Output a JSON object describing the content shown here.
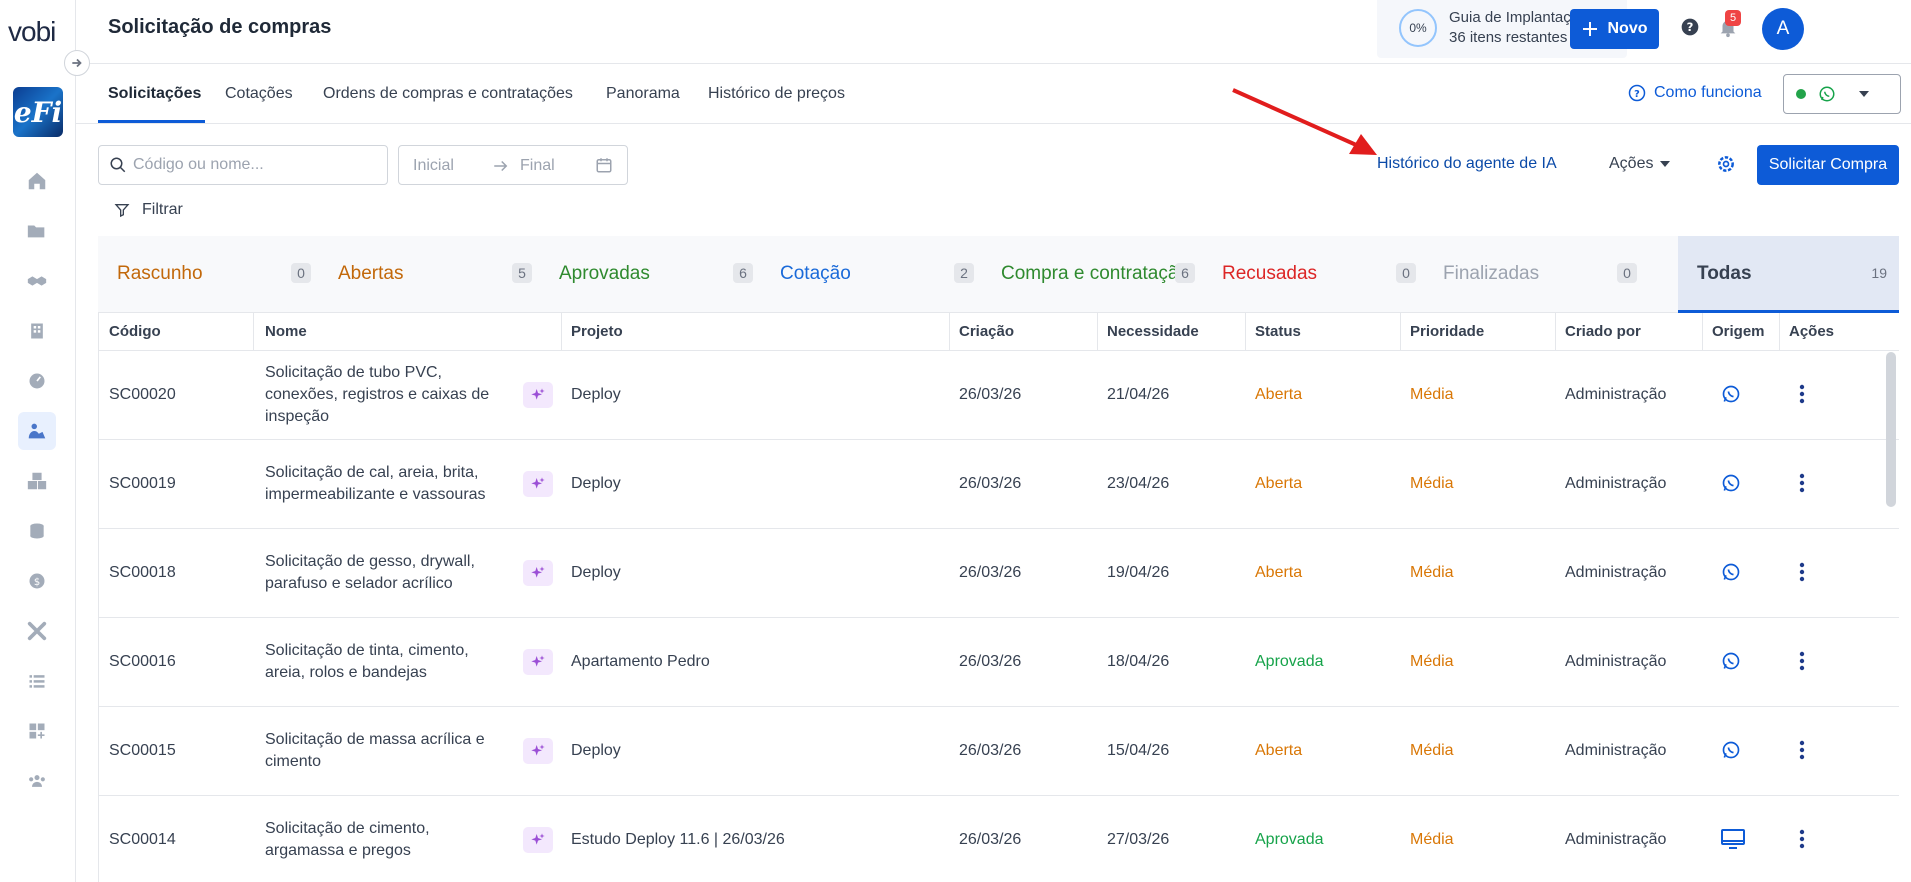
{
  "app": {
    "logo": "vobi",
    "company_logo": "eFi"
  },
  "header": {
    "title": "Solicitação de compras",
    "guide": {
      "percent": "0%",
      "title": "Guia de Implantação",
      "subtitle": "36 itens restantes"
    },
    "new_button": "Novo",
    "notifications": "5",
    "avatar": "A"
  },
  "sidebar": {
    "items": [
      {
        "icon": "home-icon"
      },
      {
        "icon": "folder-icon"
      },
      {
        "icon": "handshake-icon"
      },
      {
        "icon": "building-icon"
      },
      {
        "icon": "gauge-icon"
      },
      {
        "icon": "worker-icon",
        "active": true
      },
      {
        "icon": "boxes-icon"
      },
      {
        "icon": "coins-icon"
      },
      {
        "icon": "dollar-icon"
      },
      {
        "icon": "tools-icon"
      },
      {
        "icon": "list-icon"
      },
      {
        "icon": "grid-add-icon"
      },
      {
        "icon": "team-icon"
      }
    ]
  },
  "tabs": [
    {
      "label": "Solicitações",
      "active": true
    },
    {
      "label": "Cotações"
    },
    {
      "label": "Ordens de compras e contratações"
    },
    {
      "label": "Panorama"
    },
    {
      "label": "Histórico de preços"
    }
  ],
  "como_funciona": "Como funciona",
  "toolbar": {
    "search_placeholder": "Código ou nome...",
    "date_start": "Inicial",
    "date_end": "Final",
    "filter": "Filtrar",
    "ai_history": "Histórico do agente de IA",
    "actions": "Ações",
    "request_button": "Solicitar Compra"
  },
  "status_tabs": [
    {
      "label": "Rascunho",
      "count": "0",
      "color": "#c2680a"
    },
    {
      "label": "Abertas",
      "count": "5",
      "color": "#c2680a"
    },
    {
      "label": "Aprovadas",
      "count": "6",
      "color": "#2f8a2f"
    },
    {
      "label": "Cotação",
      "count": "2",
      "color": "#1a6ad9"
    },
    {
      "label": "Compra e contratação",
      "count": "6",
      "color": "#2f8a2f"
    },
    {
      "label": "Recusadas",
      "count": "0",
      "color": "#dc2626"
    },
    {
      "label": "Finalizadas",
      "count": "0",
      "color": "#9ca3af"
    },
    {
      "label": "Todas",
      "count": "19",
      "color": "#374151",
      "active": true
    }
  ],
  "table": {
    "columns": [
      "Código",
      "Nome",
      "Projeto",
      "Criação",
      "Necessidade",
      "Status",
      "Prioridade",
      "Criado por",
      "Origem",
      "Ações"
    ],
    "rows": [
      {
        "code": "SC00020",
        "name": "Solicitação de tubo PVC, conexões, registros e caixas de inspeção",
        "project": "Deploy",
        "created": "26/03/26",
        "needed": "21/04/26",
        "status": "Aberta",
        "priority": "Média",
        "created_by": "Administração",
        "origin": "whatsapp-icon"
      },
      {
        "code": "SC00019",
        "name": "Solicitação de cal, areia, brita, impermeabilizante e vassouras",
        "project": "Deploy",
        "created": "26/03/26",
        "needed": "23/04/26",
        "status": "Aberta",
        "priority": "Média",
        "created_by": "Administração",
        "origin": "whatsapp-icon"
      },
      {
        "code": "SC00018",
        "name": "Solicitação de gesso, drywall, parafuso e selador acrílico",
        "project": "Deploy",
        "created": "26/03/26",
        "needed": "19/04/26",
        "status": "Aberta",
        "priority": "Média",
        "created_by": "Administração",
        "origin": "whatsapp-icon"
      },
      {
        "code": "SC00016",
        "name": "Solicitação de tinta, cimento, areia, rolos e bandejas",
        "project": "Apartamento Pedro",
        "created": "26/03/26",
        "needed": "18/04/26",
        "status": "Aprovada",
        "priority": "Média",
        "created_by": "Administração",
        "origin": "whatsapp-icon"
      },
      {
        "code": "SC00015",
        "name": "Solicitação de massa acrílica e cimento",
        "project": "Deploy",
        "created": "26/03/26",
        "needed": "15/04/26",
        "status": "Aberta",
        "priority": "Média",
        "created_by": "Administração",
        "origin": "whatsapp-icon"
      },
      {
        "code": "SC00014",
        "name": "Solicitação de cimento, argamassa e pregos",
        "project": "Estudo Deploy 11.6 | 26/03/26",
        "created": "26/03/26",
        "needed": "27/03/26",
        "status": "Aprovada",
        "priority": "Média",
        "created_by": "Administração",
        "origin": "monitor-icon"
      }
    ]
  }
}
